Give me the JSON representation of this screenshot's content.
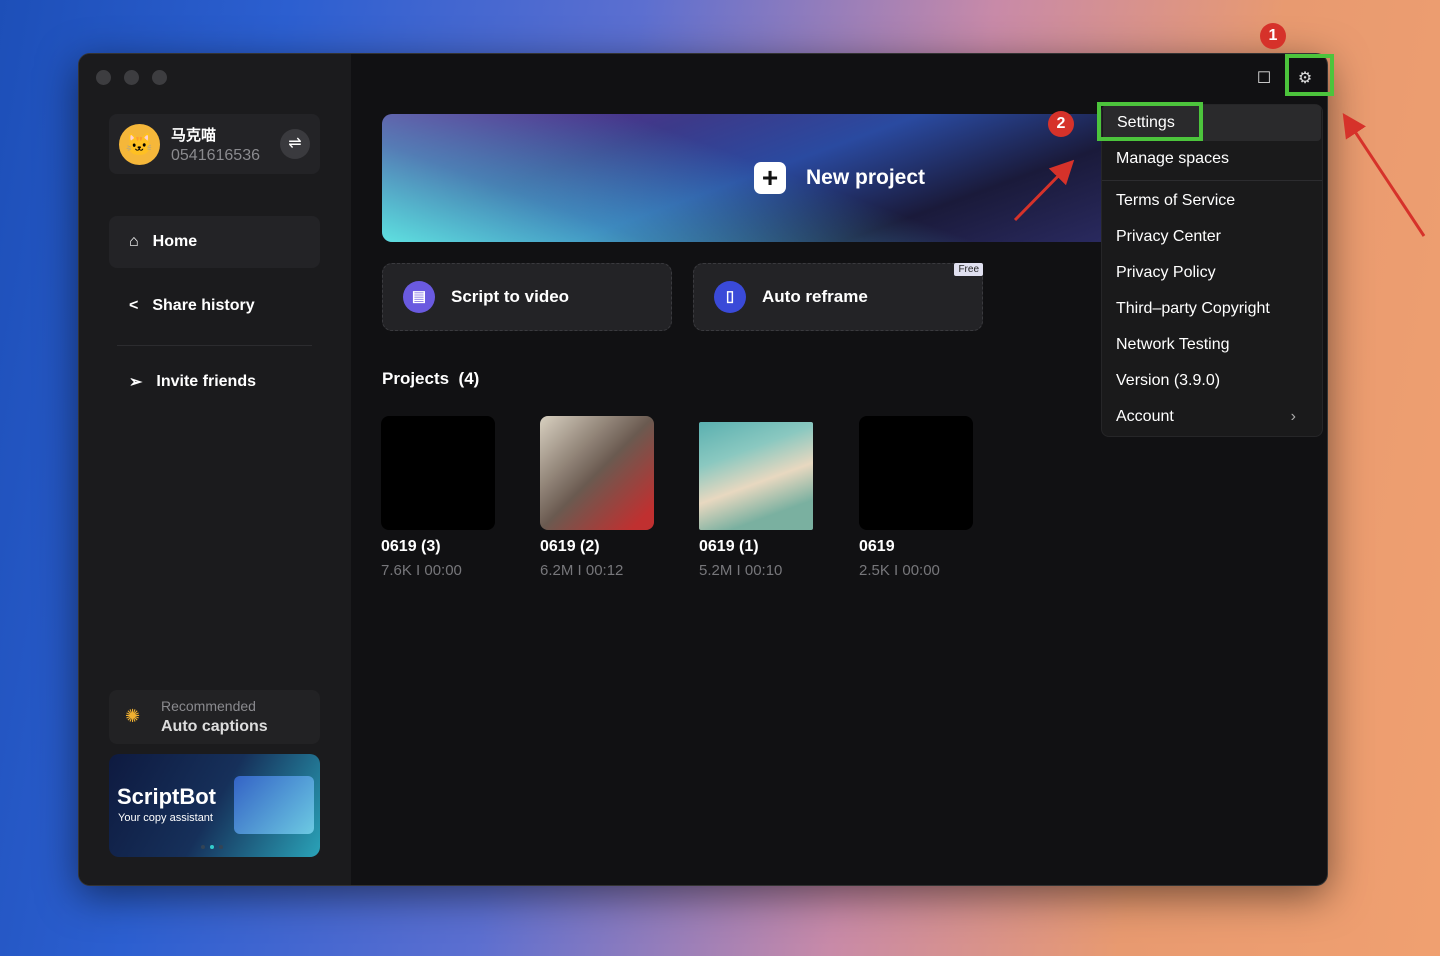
{
  "user": {
    "name": "马克喵",
    "id": "0541616536"
  },
  "sidebar": {
    "items": [
      {
        "label": "Home"
      },
      {
        "label": "Share history"
      },
      {
        "label": "Invite friends"
      }
    ],
    "recommended": {
      "label": "Recommended",
      "title": "Auto captions"
    },
    "banner": {
      "title": "ScriptBot",
      "subtitle": "Your copy assistant"
    }
  },
  "main": {
    "new_project": "New project",
    "cards": [
      {
        "label": "Script to video"
      },
      {
        "label": "Auto reframe",
        "badge": "Free"
      }
    ],
    "projects_title": "Projects",
    "projects_count": "(4)",
    "projects": [
      {
        "name": "0619 (3)",
        "meta": "7.6K I 00:00"
      },
      {
        "name": "0619 (2)",
        "meta": "6.2M I 00:12"
      },
      {
        "name": "0619 (1)",
        "meta": "5.2M I 00:10"
      },
      {
        "name": "0619",
        "meta": "2.5K I 00:00"
      }
    ]
  },
  "menu": {
    "items": [
      "Settings",
      "Manage spaces",
      "Terms of Service",
      "Privacy Center",
      "Privacy Policy",
      "Third–party Copyright",
      "Network Testing",
      "Version (3.9.0)",
      "Account"
    ]
  },
  "annotations": {
    "step1": "1",
    "step2": "2",
    "highlight_color": "#4cc43c",
    "marker_color": "#d6322a"
  }
}
